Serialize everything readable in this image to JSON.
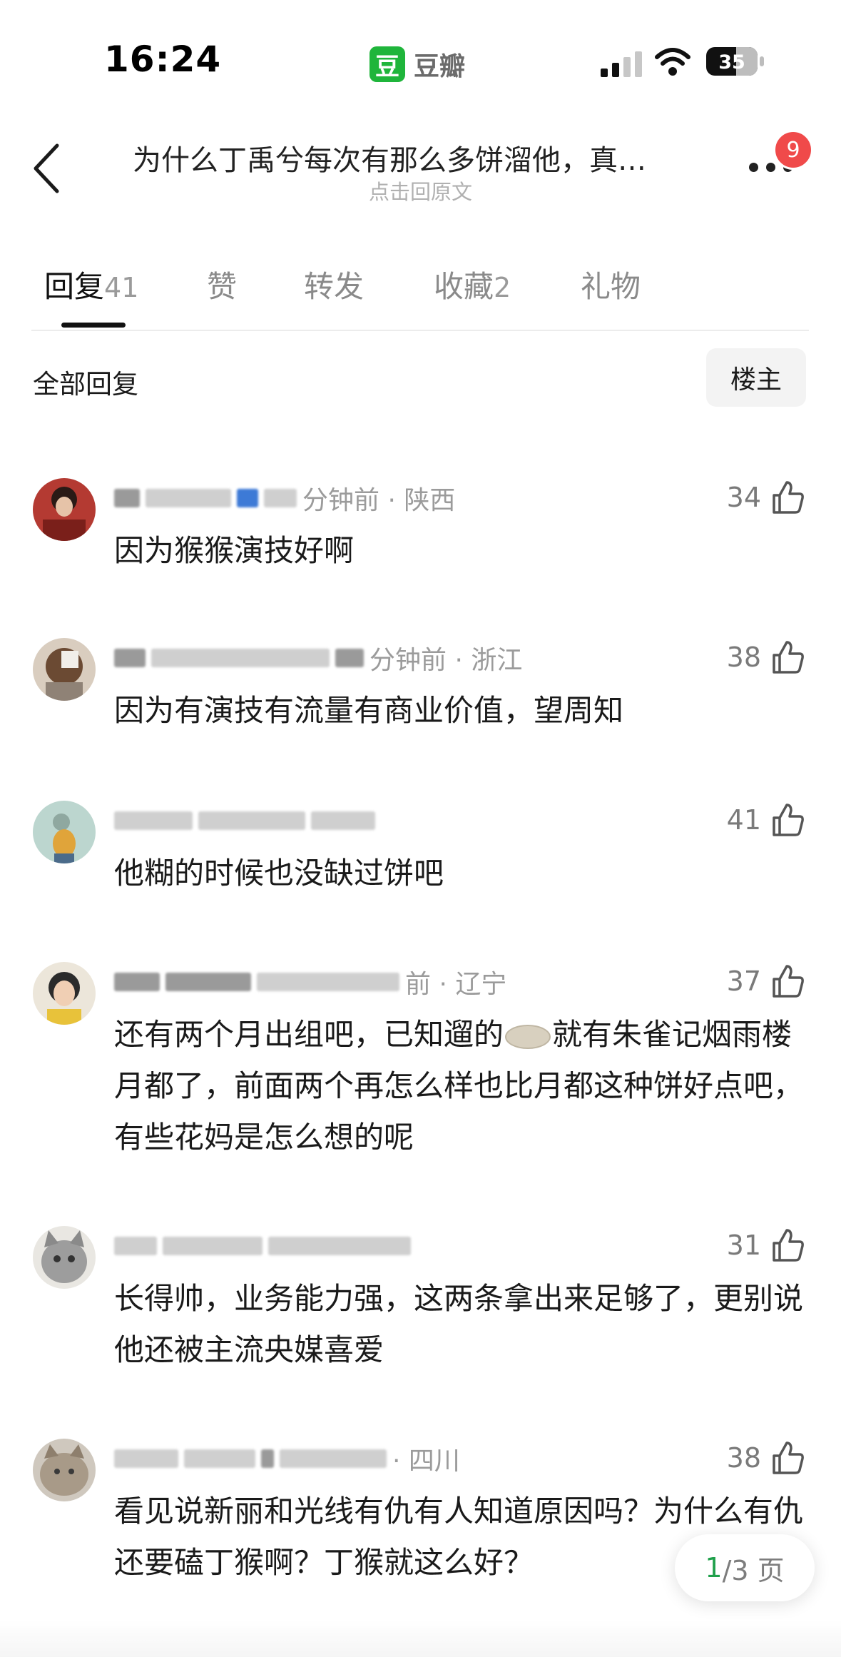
{
  "status_bar": {
    "time": "16:24",
    "app_logo": "豆",
    "app_name": "豆瓣",
    "battery": "35"
  },
  "header": {
    "title": "为什么丁禹兮每次有那么多饼溜他，真…",
    "subtitle": "点击回原文",
    "notification_count": "9"
  },
  "tabs": [
    {
      "label": "回复",
      "count": "41",
      "active": true
    },
    {
      "label": "赞",
      "count": ""
    },
    {
      "label": "转发",
      "count": ""
    },
    {
      "label": "收藏",
      "count": "2"
    },
    {
      "label": "礼物",
      "count": ""
    }
  ],
  "filter": {
    "label": "全部回复",
    "op_button": "楼主"
  },
  "comments": [
    {
      "meta": "分钟前 · 陕西",
      "likes": "34",
      "text": "因为猴猴演技好啊"
    },
    {
      "meta": "分钟前 · 浙江",
      "likes": "38",
      "text": "因为有演技有流量有商业价值，望周知"
    },
    {
      "meta": "",
      "likes": "41",
      "text": "他糊的时候也没缺过饼吧"
    },
    {
      "meta": "前 · 辽宁",
      "likes": "37",
      "text_before": "还有两个月出组吧，已知遛的",
      "text_after": "就有朱雀记烟雨楼月都了，前面两个再怎么样也比月都这种饼好点吧，有些花妈是怎么想的呢"
    },
    {
      "meta": "",
      "likes": "31",
      "text": "长得帅，业务能力强，这两条拿出来足够了，更别说他还被主流央媒喜爱"
    },
    {
      "meta": "· 四川",
      "likes": "38",
      "text": "看见说新丽和光线有仇有人知道原因吗？为什么有仇还要磕丁猴啊？丁猴就这么好？"
    }
  ],
  "pager": {
    "current": "1",
    "total": "/3 页"
  },
  "icons": {
    "back": "back-arrow-icon",
    "more": "more-dots-icon",
    "like": "thumbs-up-icon"
  },
  "colors": {
    "brand_green": "#1fb53b",
    "badge_red": "#f04a4a",
    "pager_current": "#1fa04b"
  }
}
